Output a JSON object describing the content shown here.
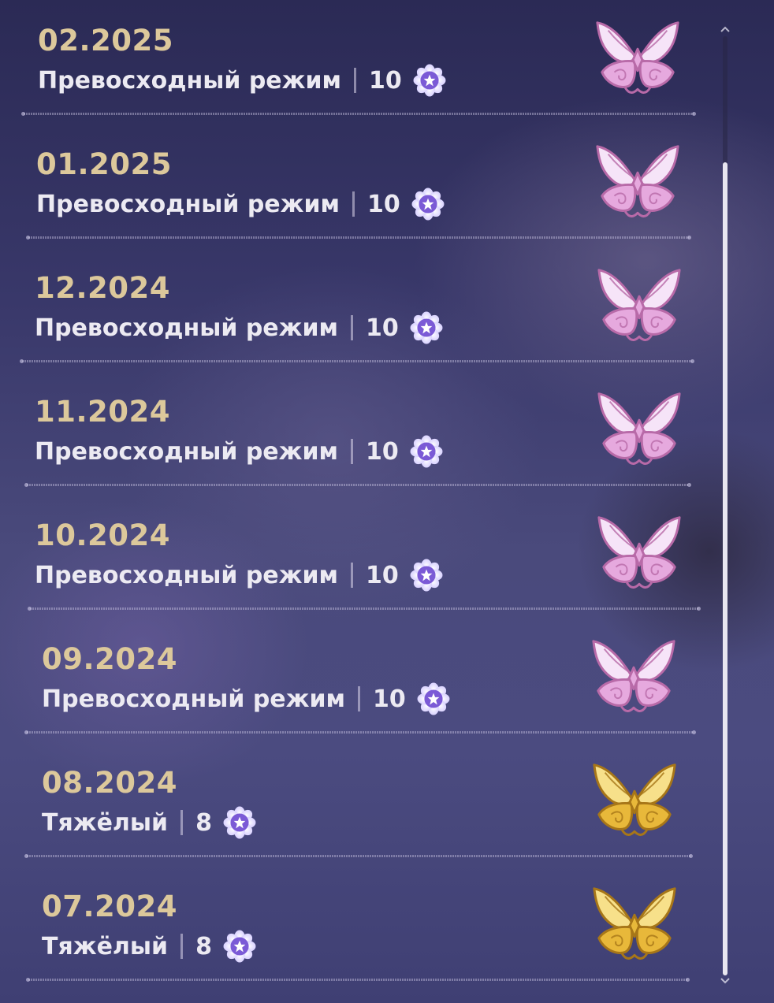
{
  "entries": [
    {
      "date": "02.2025",
      "mode": "Превосходный режим",
      "stars": "10",
      "badge": "pink"
    },
    {
      "date": "01.2025",
      "mode": "Превосходный режим",
      "stars": "10",
      "badge": "pink"
    },
    {
      "date": "12.2024",
      "mode": "Превосходный режим",
      "stars": "10",
      "badge": "pink"
    },
    {
      "date": "11.2024",
      "mode": "Превосходный режим",
      "stars": "10",
      "badge": "pink"
    },
    {
      "date": "10.2024",
      "mode": "Превосходный режим",
      "stars": "10",
      "badge": "pink"
    },
    {
      "date": "09.2024",
      "mode": "Превосходный режим",
      "stars": "10",
      "badge": "pink"
    },
    {
      "date": "08.2024",
      "mode": "Тяжёлый",
      "stars": "8",
      "badge": "gold"
    },
    {
      "date": "07.2024",
      "mode": "Тяжёлый",
      "stars": "8",
      "badge": "gold"
    }
  ],
  "icons": {
    "star": "star-flower-icon",
    "badge_pink": "pink-butterfly-badge-icon",
    "badge_gold": "gold-butterfly-badge-icon"
  },
  "colors": {
    "date": "#dcc89b",
    "text": "#eceaf2",
    "star": "#7b5ad6",
    "badge_pink": "#e9b7e6",
    "badge_gold": "#e8c04a"
  }
}
